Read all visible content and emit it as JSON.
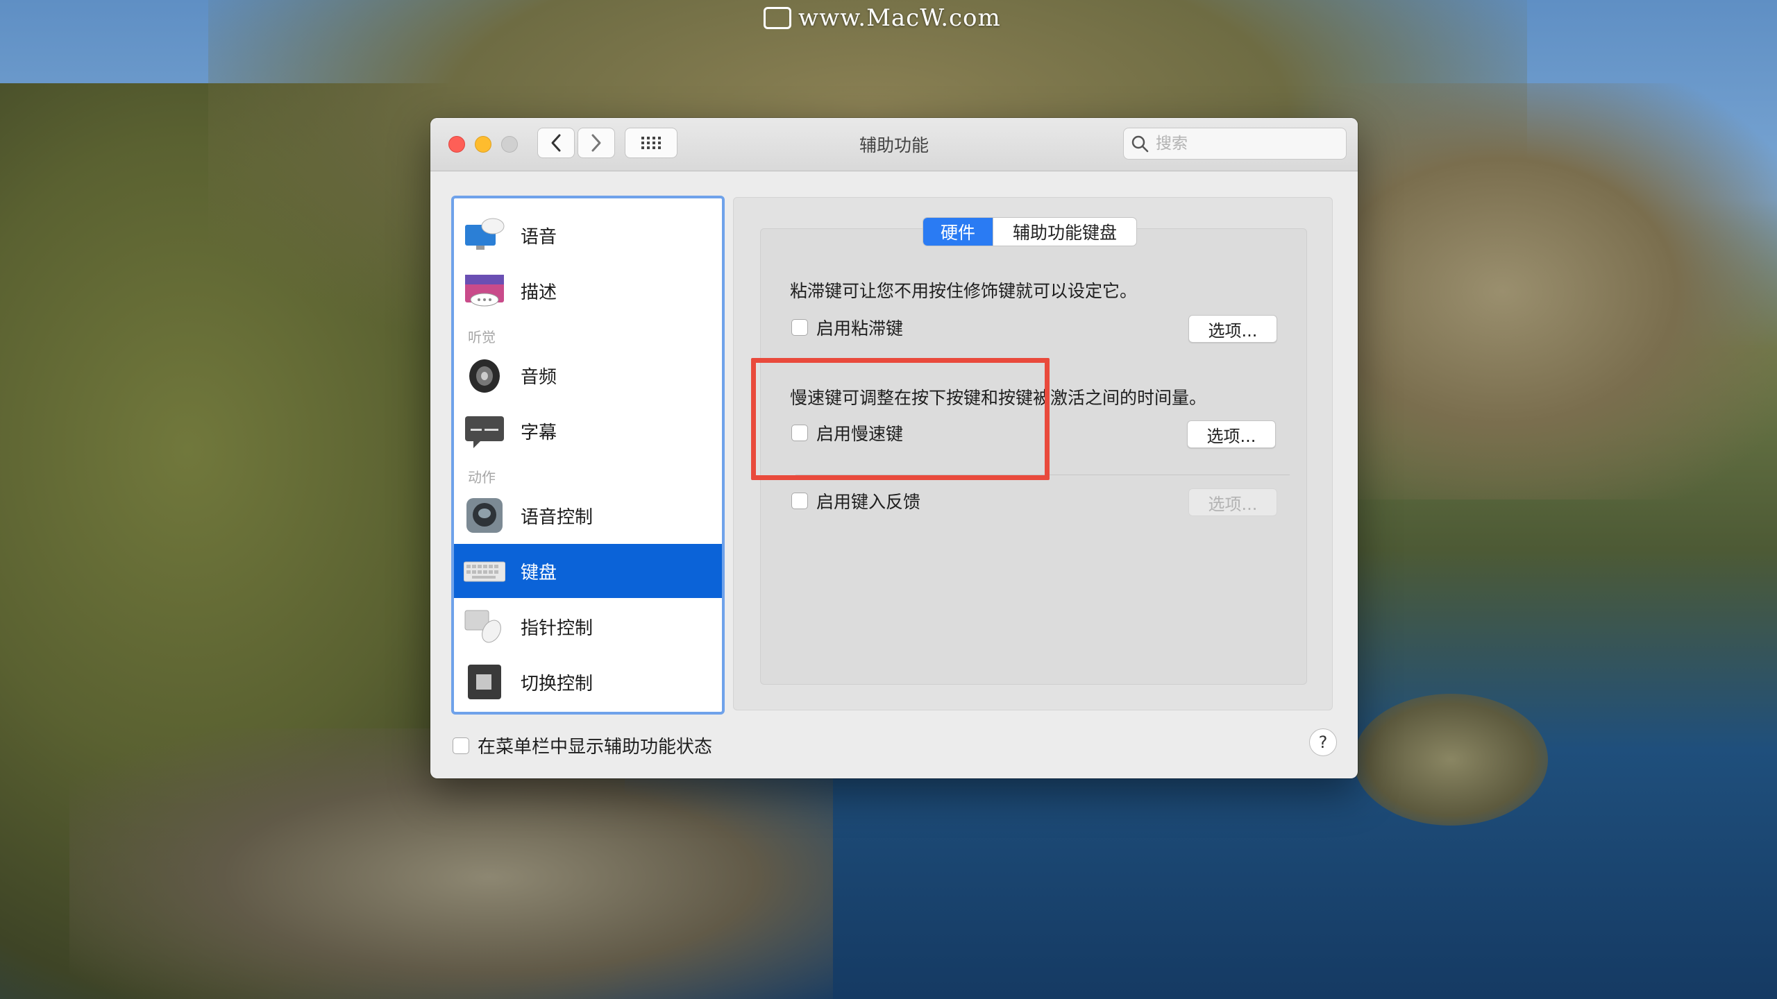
{
  "watermark": "www.MacW.com",
  "window": {
    "title": "辅助功能",
    "search_placeholder": "搜索"
  },
  "sidebar": {
    "items": [
      {
        "label": "语音",
        "icon": "speech-icon"
      },
      {
        "label": "描述",
        "icon": "descriptions-icon"
      },
      {
        "label": "音频",
        "icon": "audio-speaker-icon"
      },
      {
        "label": "字幕",
        "icon": "captions-icon"
      },
      {
        "label": "语音控制",
        "icon": "voice-control-icon"
      },
      {
        "label": "键盘",
        "icon": "keyboard-icon",
        "selected": true
      },
      {
        "label": "指针控制",
        "icon": "pointer-control-icon"
      },
      {
        "label": "切换控制",
        "icon": "switch-control-icon"
      }
    ],
    "sections": {
      "hearing": "听觉",
      "motor": "动作"
    }
  },
  "tabs": {
    "hardware": "硬件",
    "accessibility_keyboard": "辅助功能键盘",
    "active": "hardware"
  },
  "sticky_keys": {
    "description": "粘滞键可让您不用按住修饰键就可以设定它。",
    "checkbox_label": "启用粘滞键",
    "checked": false,
    "options_label": "选项..."
  },
  "slow_keys": {
    "description": "慢速键可调整在按下按键和按键被激活之间的时间量。",
    "checkbox_label": "启用慢速键",
    "checked": false,
    "options_label": "选项..."
  },
  "key_feedback": {
    "checkbox_label": "启用键入反馈",
    "checked": false,
    "options_label": "选项...",
    "options_enabled": false
  },
  "footer": {
    "menu_bar_checkbox_label": "在菜单栏中显示辅助功能状态",
    "checked": false,
    "help_label": "?"
  },
  "colors": {
    "highlight_border": "#e94a3c",
    "selection": "#0b63d8",
    "active_tab": "#2a7bf3"
  }
}
